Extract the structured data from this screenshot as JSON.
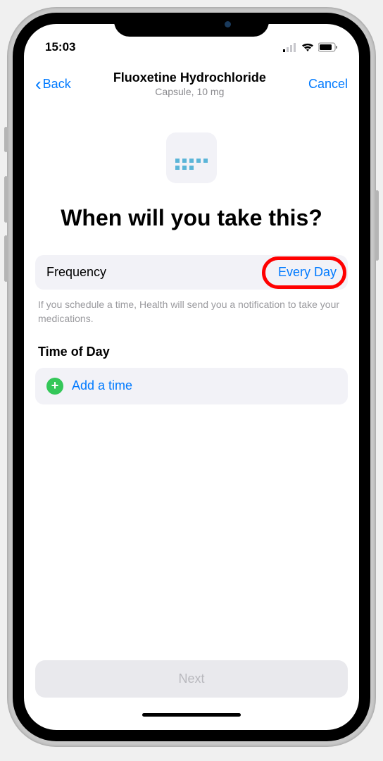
{
  "status": {
    "time": "15:03"
  },
  "nav": {
    "back": "Back",
    "title": "Fluoxetine Hydrochloride",
    "subtitle": "Capsule, 10 mg",
    "cancel": "Cancel"
  },
  "heading": "When will you take this?",
  "frequency": {
    "label": "Frequency",
    "value": "Every Day"
  },
  "helper": "If you schedule a time, Health will send you a notification to take your medications.",
  "time_section": {
    "header": "Time of Day",
    "add_label": "Add a time"
  },
  "next_label": "Next"
}
